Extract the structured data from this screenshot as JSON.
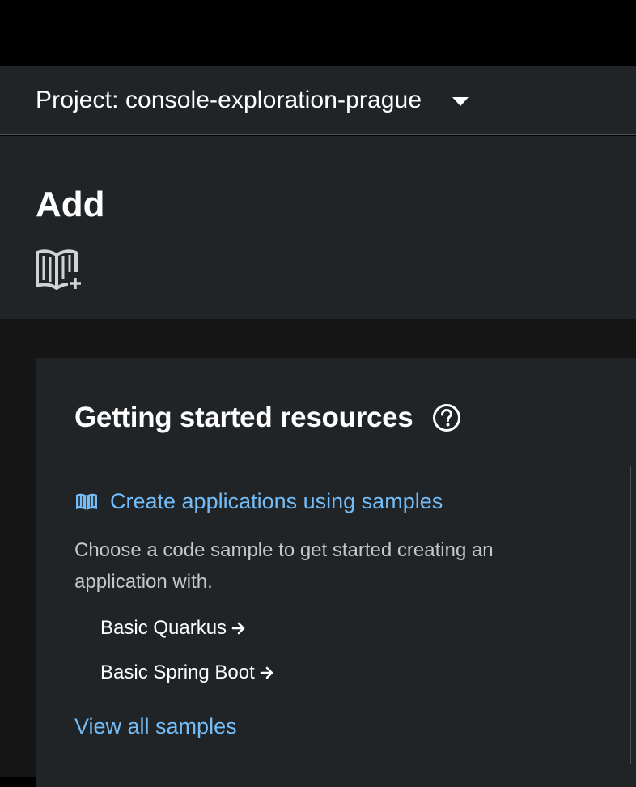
{
  "project_bar": {
    "label": "Project: console-exploration-prague"
  },
  "header": {
    "title": "Add",
    "icon": "book-add-icon"
  },
  "card": {
    "title": "Getting started resources",
    "help_icon": "help-circle-icon",
    "resource": {
      "icon": "book-open-icon",
      "link_label": "Create applications using samples",
      "description": "Choose a code sample to get started creating an application with."
    },
    "samples": [
      {
        "label": "Basic Quarkus"
      },
      {
        "label": "Basic Spring Boot"
      }
    ],
    "view_all_label": "View all samples"
  },
  "colors": {
    "background": "#000000",
    "panel": "#212427",
    "content_bg": "#151515",
    "link": "#73bcf7",
    "muted_text": "#c7c7c7"
  }
}
